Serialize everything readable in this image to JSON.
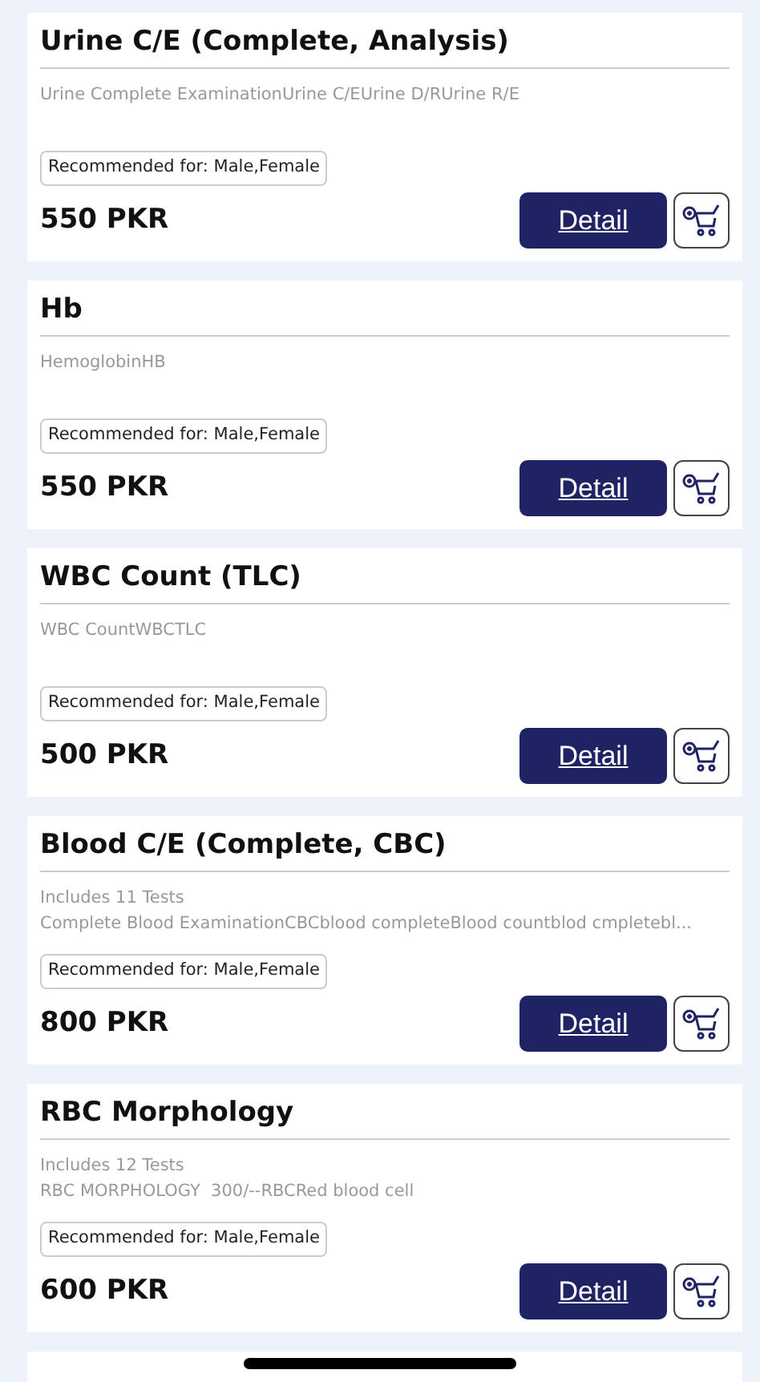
{
  "tests": [
    {
      "title": "Urine C/E (Complete, Analysis)",
      "description": [
        "Urine Complete ExaminationUrine C/EUrine D/RUrine R/E"
      ],
      "recommended": "Recommended for: Male,Female",
      "price": "550 PKR",
      "detail_label": "Detail"
    },
    {
      "title": "Hb",
      "description": [
        "HemoglobinHB"
      ],
      "recommended": "Recommended for: Male,Female",
      "price": "550 PKR",
      "detail_label": "Detail"
    },
    {
      "title": "WBC Count (TLC)",
      "description": [
        "WBC CountWBCTLC"
      ],
      "recommended": "Recommended for: Male,Female",
      "price": "500 PKR",
      "detail_label": "Detail"
    },
    {
      "title": "Blood C/E (Complete, CBC)",
      "description": [
        "Includes 11 Tests",
        "Complete Blood ExaminationCBCblood completeBlood countblod cmpletebl..."
      ],
      "recommended": "Recommended for: Male,Female",
      "price": "800 PKR",
      "detail_label": "Detail"
    },
    {
      "title": "RBC Morphology",
      "description": [
        "Includes 12 Tests",
        "RBC MORPHOLOGY  300/--RBCRed blood cell"
      ],
      "recommended": "Recommended for: Male,Female",
      "price": "600 PKR",
      "detail_label": "Detail"
    }
  ]
}
